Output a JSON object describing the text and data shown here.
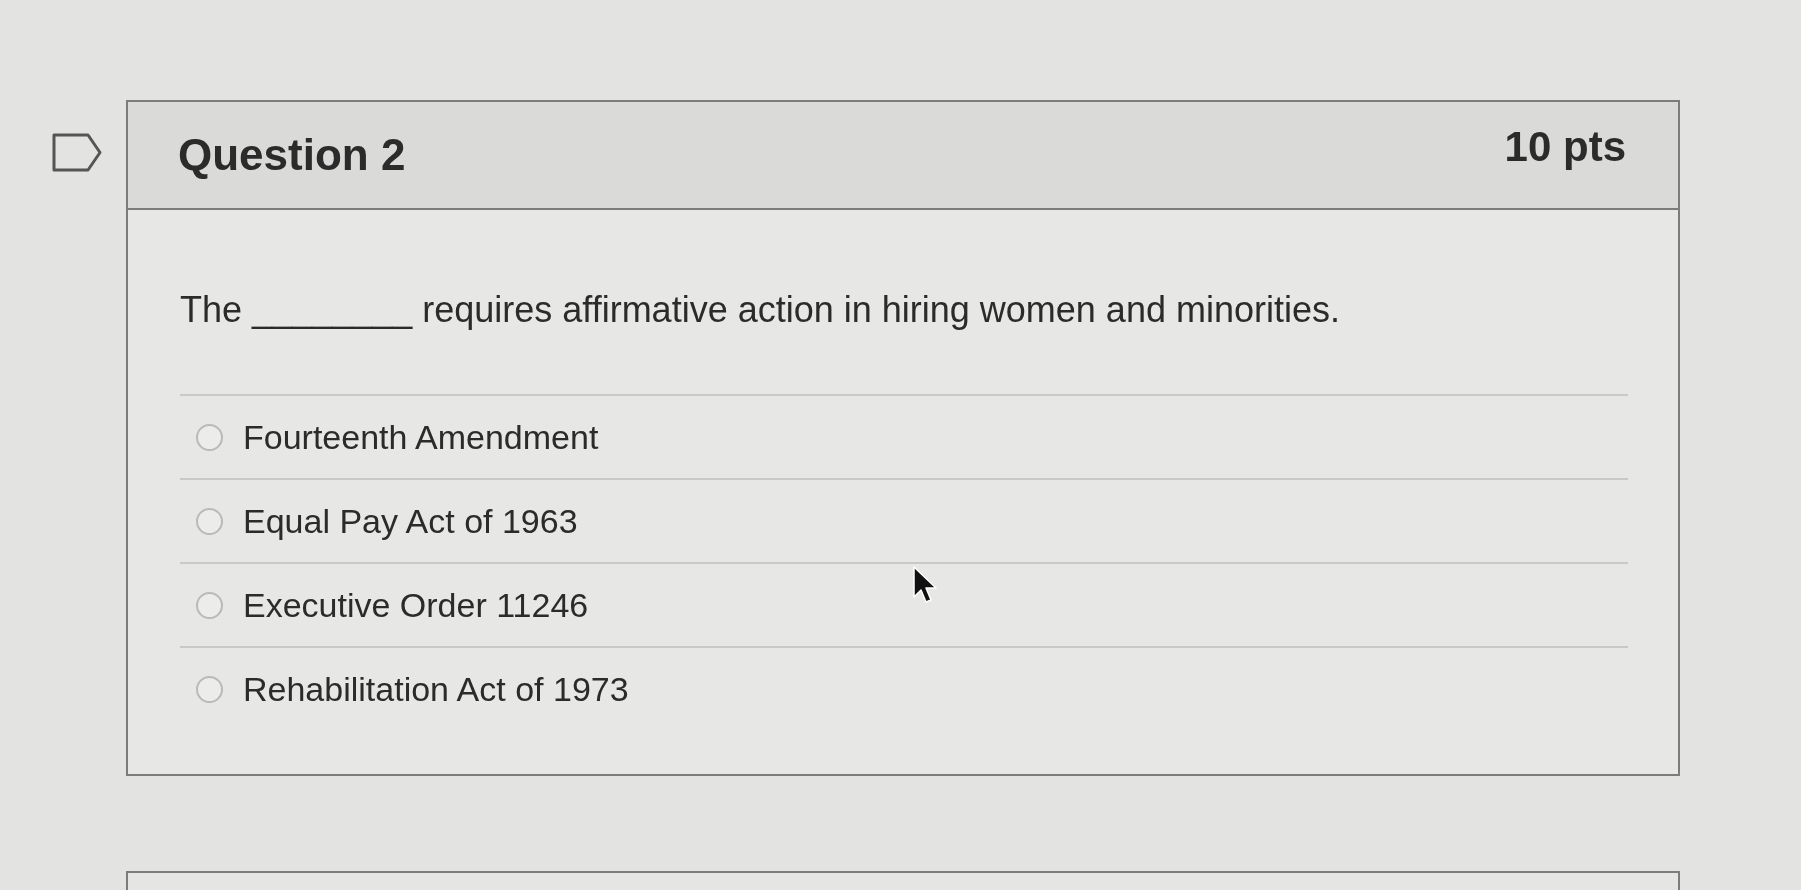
{
  "question": {
    "title": "Question 2",
    "points": "10 pts",
    "stem": "The ________ requires affirmative action in hiring women and minorities.",
    "answers": [
      {
        "label": "Fourteenth Amendment",
        "selected": false
      },
      {
        "label": "Equal Pay Act of 1963",
        "selected": false
      },
      {
        "label": "Executive Order 11246",
        "selected": false
      },
      {
        "label": "Rehabilitation Act of 1973",
        "selected": false
      }
    ]
  }
}
